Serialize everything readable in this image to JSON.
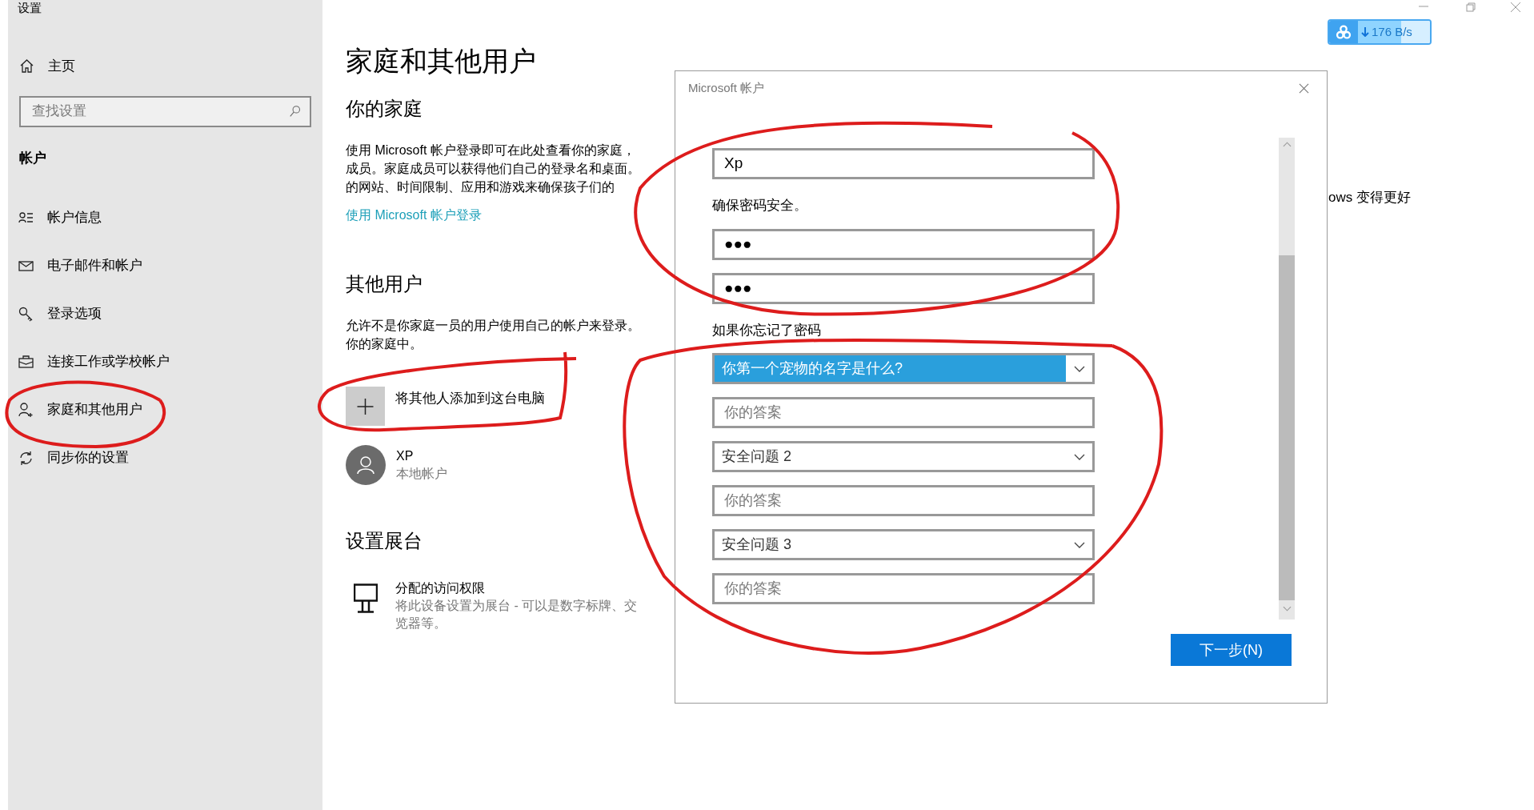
{
  "window": {
    "title": "设置"
  },
  "sidebar": {
    "home": "主页",
    "search": {
      "placeholder": "查找设置"
    },
    "section": "帐户",
    "items": [
      {
        "kind": "account-info",
        "label": "帐户信息"
      },
      {
        "kind": "mail",
        "label": "电子邮件和帐户"
      },
      {
        "kind": "key",
        "label": "登录选项"
      },
      {
        "kind": "briefcase",
        "label": "连接工作或学校帐户"
      },
      {
        "kind": "person-add",
        "label": "家庭和其他用户"
      },
      {
        "kind": "sync",
        "label": "同步你的设置"
      }
    ]
  },
  "main": {
    "title": "家庭和其他用户",
    "family": {
      "heading": "你的家庭",
      "description": [
        "使用 Microsoft 帐户登录即可在此处查看你的家庭，",
        "成员。家庭成员可以获得他们自己的登录名和桌面。",
        "的网站、时间限制、应用和游戏来确保孩子们的"
      ],
      "link": "使用 Microsoft 帐户登录"
    },
    "other_users": {
      "heading": "其他用户",
      "description": [
        "允许不是你家庭一员的用户使用自己的帐户来登录。",
        "你的家庭中。"
      ],
      "add_label": "将其他人添加到这台电脑",
      "users": [
        {
          "name": "XP",
          "type": "本地帐户"
        }
      ]
    },
    "kiosk": {
      "heading": "设置展台",
      "item_title": "分配的访问权限",
      "item_description": [
        "将此设备设置为展台 - 可以是数字标牌、交",
        "览器等。"
      ]
    },
    "side_text": "ows 变得更好"
  },
  "speed_badge": {
    "reading": "176 B/s"
  },
  "dialog": {
    "title": "Microsoft 帐户",
    "rows": [
      {
        "kind": "input",
        "value": "Xp"
      },
      {
        "kind": "note",
        "text": "确保密码安全。"
      },
      {
        "kind": "input",
        "value": "●●●"
      },
      {
        "kind": "input",
        "value": "●●●"
      },
      {
        "kind": "note",
        "text": "如果你忘记了密码"
      },
      {
        "kind": "select",
        "text": "你第一个宠物的名字是什么?",
        "selected": true
      },
      {
        "kind": "answer",
        "placeholder": "你的答案"
      },
      {
        "kind": "select",
        "text": "安全问题 2",
        "selected": false
      },
      {
        "kind": "answer",
        "placeholder": "你的答案"
      },
      {
        "kind": "select",
        "text": "安全问题 3",
        "selected": false
      },
      {
        "kind": "answer",
        "placeholder": "你的答案"
      }
    ],
    "button": "下一步(N)"
  }
}
